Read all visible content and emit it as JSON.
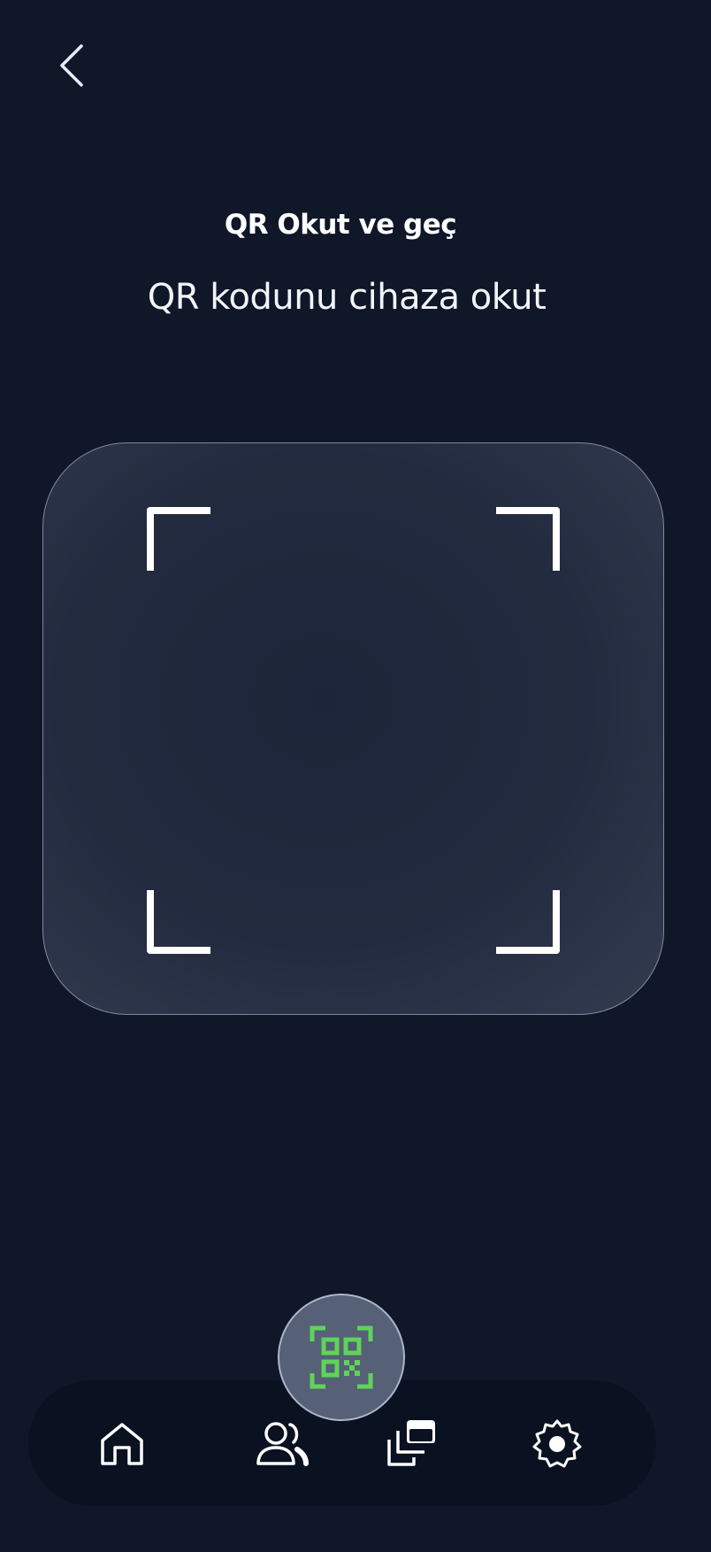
{
  "header": {
    "title": "QR Okut ve geç",
    "subtitle": "QR kodunu cihaza okut"
  },
  "icons": {
    "back": "chevron-left-icon",
    "scan": "qr-code-icon",
    "home": "home-icon",
    "users": "users-icon",
    "cards": "cards-icon",
    "settings": "gear-icon"
  },
  "colors": {
    "background": "#0f1729",
    "accent_green": "#5fd35a",
    "fab_background": "#566076",
    "nav_background": "#0a1222"
  }
}
